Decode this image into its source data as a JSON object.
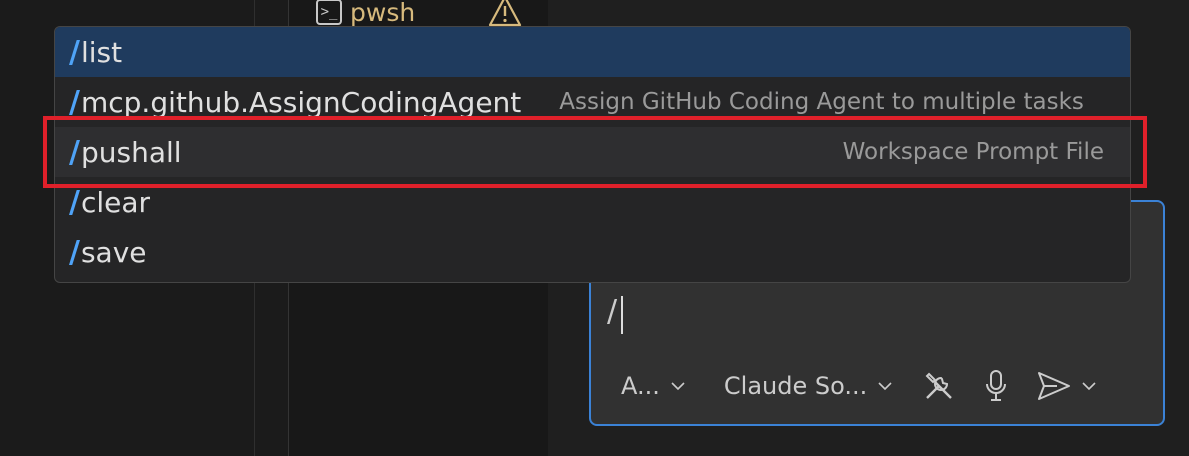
{
  "terminal": {
    "tab_icon_glyph": ">_",
    "tab_name": "pwsh"
  },
  "completions": [
    {
      "slash": "/",
      "command": "list",
      "description": "",
      "state": "selected"
    },
    {
      "slash": "/",
      "command": "mcp.github.AssignCodingAgent",
      "description": "Assign GitHub Coding Agent to multiple tasks",
      "state": "normal"
    },
    {
      "slash": "/",
      "command": "pushall",
      "description": "Workspace Prompt File",
      "state": "hovered"
    },
    {
      "slash": "/",
      "command": "clear",
      "description": "",
      "state": "normal"
    },
    {
      "slash": "/",
      "command": "save",
      "description": "",
      "state": "normal"
    }
  ],
  "chat": {
    "input_value": "/",
    "mode_label": "A...",
    "model_label": "Claude So...",
    "tools_icon": "tools-icon",
    "mic_icon": "microphone-icon",
    "send_icon": "send-icon"
  },
  "colors": {
    "accent": "#3b82d6",
    "slash": "#4fa3f7",
    "selected_row": "#1f3b5e",
    "highlight_box": "#e0202a",
    "terminal_name": "#d7ba7d"
  }
}
